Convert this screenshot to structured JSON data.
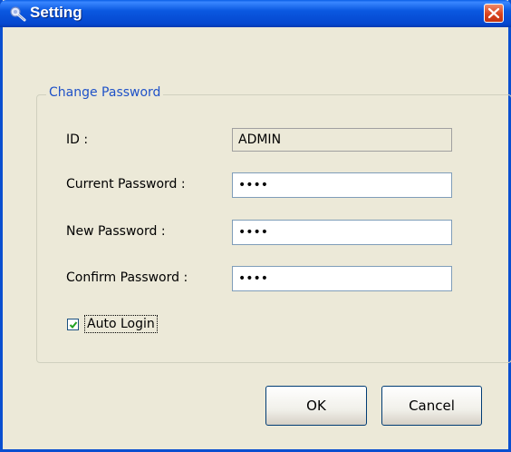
{
  "window": {
    "title": "Setting"
  },
  "group": {
    "title": "Change Password"
  },
  "fields": {
    "id_label": "ID :",
    "id_value": "ADMIN",
    "current_label": "Current Password :",
    "current_value": "••••",
    "new_label": "New Password :",
    "new_value": "••••",
    "confirm_label": "Confirm Password :",
    "confirm_value": "••••"
  },
  "auto_login": {
    "label": "Auto Login",
    "checked": true
  },
  "buttons": {
    "ok": "OK",
    "cancel": "Cancel"
  },
  "colors": {
    "title_bar": "#0a58e0",
    "close_button": "#d9431e",
    "group_title": "#1f52c8",
    "dialog_bg": "#ece9d8"
  },
  "icons": {
    "app": "setting-icon",
    "close": "close-icon",
    "check": "checkmark-icon"
  }
}
